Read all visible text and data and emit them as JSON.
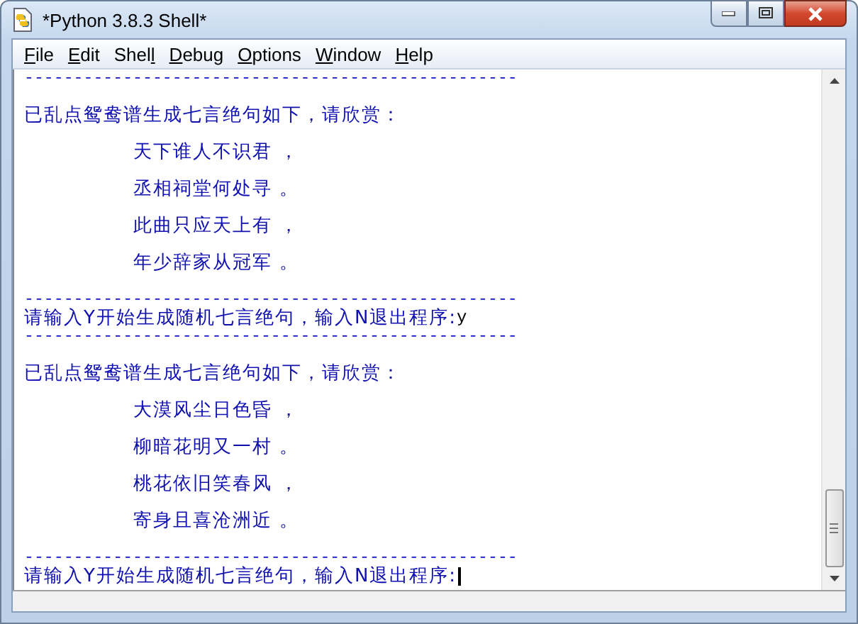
{
  "window": {
    "title": "*Python 3.8.3 Shell*"
  },
  "menu": [
    {
      "label_parts": [
        {
          "text": "F",
          "underline": true
        },
        {
          "text": "ile",
          "underline": false
        }
      ]
    },
    {
      "label_parts": [
        {
          "text": "E",
          "underline": true
        },
        {
          "text": "dit",
          "underline": false
        }
      ]
    },
    {
      "label_parts": [
        {
          "text": "Shel",
          "underline": false
        },
        {
          "text": "l",
          "underline": true
        }
      ]
    },
    {
      "label_parts": [
        {
          "text": "D",
          "underline": true
        },
        {
          "text": "ebug",
          "underline": false
        }
      ]
    },
    {
      "label_parts": [
        {
          "text": "O",
          "underline": true
        },
        {
          "text": "ptions",
          "underline": false
        }
      ]
    },
    {
      "label_parts": [
        {
          "text": "W",
          "underline": true
        },
        {
          "text": "indow",
          "underline": false
        }
      ]
    },
    {
      "label_parts": [
        {
          "text": "H",
          "underline": true
        },
        {
          "text": "elp",
          "underline": false
        }
      ]
    }
  ],
  "shell_lines": [
    {
      "kind": "rule",
      "text": "--------------------------------------------------"
    },
    {
      "kind": "text",
      "text": "已乱点鸳鸯谱生成七言绝句如下，请欣赏："
    },
    {
      "kind": "poem",
      "text": "天下谁人不识君 ，"
    },
    {
      "kind": "poem",
      "text": "丞相祠堂何处寻 。"
    },
    {
      "kind": "poem",
      "text": "此曲只应天上有 ，"
    },
    {
      "kind": "poem",
      "text": "年少辞家从冠军 。"
    },
    {
      "kind": "rule",
      "text": "--------------------------------------------------"
    },
    {
      "kind": "prompt",
      "text": "请输入Y开始生成随机七言绝句，输入N退出程序:",
      "input": "y",
      "cursor": false
    },
    {
      "kind": "rule",
      "text": "--------------------------------------------------"
    },
    {
      "kind": "text",
      "text": "已乱点鸳鸯谱生成七言绝句如下，请欣赏："
    },
    {
      "kind": "poem",
      "text": "大漠风尘日色昏 ，"
    },
    {
      "kind": "poem",
      "text": "柳暗花明又一村 。"
    },
    {
      "kind": "poem",
      "text": "桃花依旧笑春风 ，"
    },
    {
      "kind": "poem",
      "text": "寄身且喜沧洲近 。"
    },
    {
      "kind": "rule",
      "text": "--------------------------------------------------"
    },
    {
      "kind": "prompt",
      "text": "请输入Y开始生成随机七言绝句，输入N退出程序:",
      "cursor": true
    }
  ]
}
